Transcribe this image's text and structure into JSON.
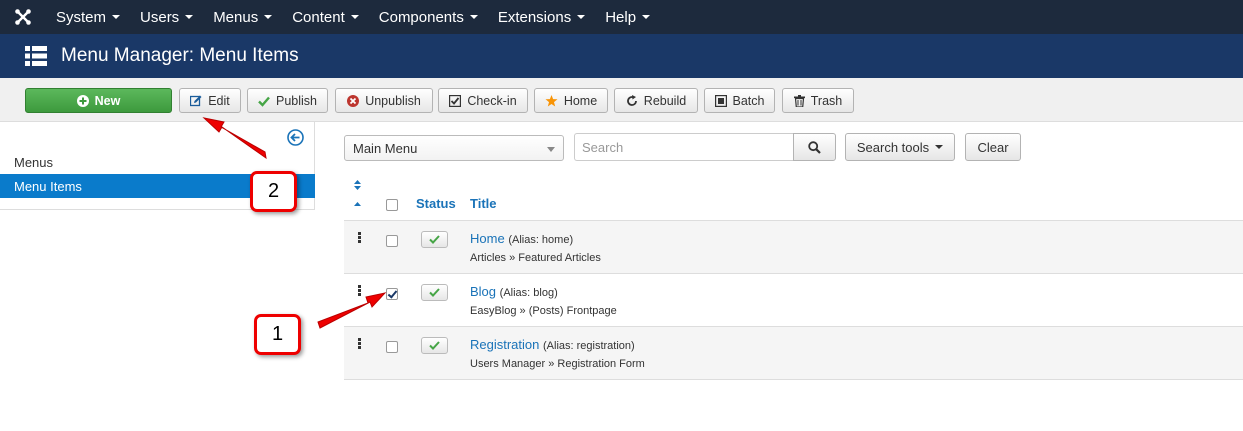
{
  "navbar": {
    "items": [
      {
        "label": "System"
      },
      {
        "label": "Users"
      },
      {
        "label": "Menus"
      },
      {
        "label": "Content"
      },
      {
        "label": "Components"
      },
      {
        "label": "Extensions"
      },
      {
        "label": "Help"
      }
    ]
  },
  "header": {
    "title": "Menu Manager: Menu Items"
  },
  "toolbar": {
    "new": "New",
    "edit": "Edit",
    "publish": "Publish",
    "unpublish": "Unpublish",
    "checkin": "Check-in",
    "home": "Home",
    "rebuild": "Rebuild",
    "batch": "Batch",
    "trash": "Trash"
  },
  "sidebar": {
    "items": [
      {
        "label": "Menus",
        "active": false
      },
      {
        "label": "Menu Items",
        "active": true
      }
    ]
  },
  "filters": {
    "menu_select": "Main Menu",
    "search_placeholder": "Search",
    "search_value": "",
    "search_tools": "Search tools",
    "clear": "Clear"
  },
  "table": {
    "headers": {
      "status": "Status",
      "title": "Title"
    },
    "rows": [
      {
        "title": "Home",
        "alias": "(Alias: home)",
        "type": "Articles » Featured Articles",
        "checked": false,
        "published": true
      },
      {
        "title": "Blog",
        "alias": "(Alias: blog)",
        "type": "EasyBlog » (Posts) Frontpage",
        "checked": true,
        "published": true
      },
      {
        "title": "Registration",
        "alias": "(Alias: registration)",
        "type": "Users Manager » Registration Form",
        "checked": false,
        "published": true
      }
    ]
  },
  "annotations": {
    "callout_1": "1",
    "callout_2": "2"
  },
  "colors": {
    "navbar": "#1d2a3d",
    "header": "#1a3867",
    "new_button": "#4cae4c",
    "active_sidebar": "#0a7bcb",
    "link": "#1a73b8",
    "annotation": "#e00000"
  }
}
